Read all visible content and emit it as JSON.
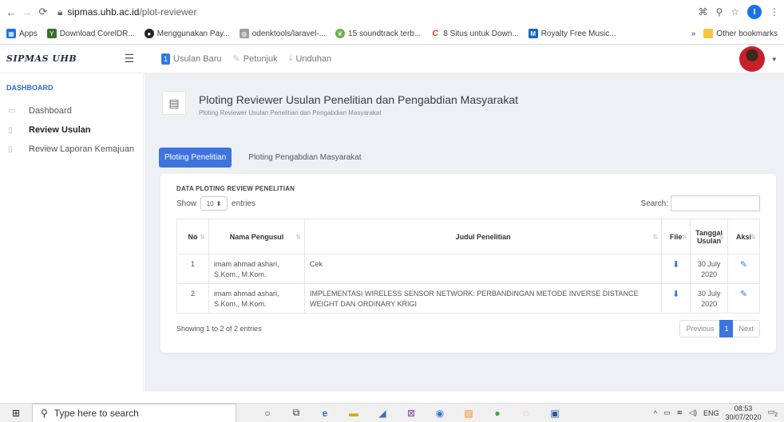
{
  "browser": {
    "host": "sipmas.uhb.ac.id",
    "path": "/plot-reviewer",
    "profile_initial": "I",
    "bookmarks": [
      {
        "label": "Apps",
        "icon": "apps-grid-icon",
        "color": "#1a73e8"
      },
      {
        "label": "Download CorelDR...",
        "icon": "corel-icon",
        "color": "#3b6e2e"
      },
      {
        "label": "Menggunakan Pay...",
        "icon": "github-icon",
        "color": "#222222"
      },
      {
        "label": "odenktools/laravel-...",
        "icon": "page-icon",
        "color": "#9e9e9e"
      },
      {
        "label": "15 soundtrack terb...",
        "icon": "leaf-icon",
        "color": "#6ab04c"
      },
      {
        "label": "8 Situs untuk Down...",
        "icon": "c-logo-icon",
        "color": "#e53935"
      },
      {
        "label": "Royalty Free Music...",
        "icon": "m-logo-icon",
        "color": "#1565c0"
      }
    ],
    "more_bookmarks": "»",
    "other_bookmarks": "Other bookmarks"
  },
  "header": {
    "brand": "SIPMAS UHB",
    "menu": [
      {
        "label": "Usulan Baru",
        "badge": "1"
      },
      {
        "label": "Petunjuk"
      },
      {
        "label": "Unduhan"
      }
    ]
  },
  "sidebar": {
    "section": "DASHBOARD",
    "items": [
      {
        "label": "Dashboard"
      },
      {
        "label": "Review Usulan"
      },
      {
        "label": "Review Laporan Kemajuan"
      }
    ]
  },
  "page": {
    "title": "Ploting Reviewer Usulan Penelitian dan Pengabdian Masyarakat",
    "subtitle": "Ploting Reviewer Usulan Penelitian dan Pengabdian Masyarakat"
  },
  "tabs": [
    {
      "label": "Ploting Penelitian"
    },
    {
      "label": "Ploting Pengabdian Masyarakat"
    }
  ],
  "table": {
    "title": "DATA PLOTING REVIEW PENELITIAN",
    "show_label": "Show",
    "entries_value": "10",
    "entries_label": "entries",
    "search_label": "Search:",
    "columns": [
      "No",
      "Nama Pengusul",
      "Judul Penelitian",
      "File",
      "Tanggal Usulan",
      "Aksi"
    ],
    "rows": [
      {
        "no": "1",
        "nama": "imam ahmad ashari, S.Kom., M.Kom.",
        "judul": "Cek",
        "tanggal": "30 July 2020"
      },
      {
        "no": "2",
        "nama": "imam ahmad ashari, S.Kom., M.Kom.",
        "judul": "IMPLEMENTASI WIRELESS SENSOR NETWORK: PERBANDINGAN METODE INVERSE DISTANCE WEIGHT DAN ORDINARY KRIGI",
        "tanggal": "30 July 2020"
      }
    ],
    "info": "Showing 1 to 2 of 2 entries",
    "prev": "Previous",
    "page": "1",
    "next": "Next"
  },
  "taskbar": {
    "search_placeholder": "Type here to search",
    "lang": "ENG",
    "time": "08:53",
    "date": "30/07/2020",
    "notif_count": "2"
  }
}
